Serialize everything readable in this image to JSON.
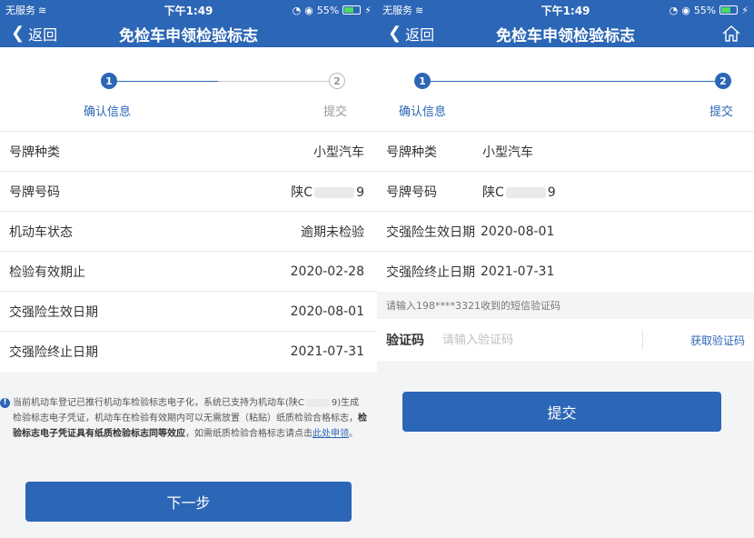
{
  "left": {
    "status": {
      "carrier": "无服务",
      "time": "下午1:49",
      "battery": "55%"
    },
    "nav": {
      "back": "返回",
      "title": "免检车申领检验标志"
    },
    "steps": [
      {
        "num": "1",
        "label": "确认信息"
      },
      {
        "num": "2",
        "label": "提交"
      }
    ],
    "rows": [
      {
        "label": "号牌种类",
        "value": "小型汽车"
      },
      {
        "label": "号牌号码",
        "value_prefix": "陕C",
        "value_suffix": "9"
      },
      {
        "label": "机动车状态",
        "value": "逾期未检验"
      },
      {
        "label": "检验有效期止",
        "value": "2020-02-28"
      },
      {
        "label": "交强险生效日期",
        "value": "2020-08-01"
      },
      {
        "label": "交强险终止日期",
        "value": "2021-07-31"
      }
    ],
    "notice": {
      "part1": "当前机动车登记已推行机动车检验标志电子化，系统已支持为机动车(陕C",
      "part2": "9)生成检验标志电子凭证，机动车在检验有效期内可以无需放置（粘贴）纸质检验合格标志，",
      "part3": "检验标志电子凭证具有纸质检验标志同等效应",
      "part4": "，如需纸质检验合格标志请点击",
      "link": "此处申领",
      "part5": "。"
    },
    "button": "下一步"
  },
  "right": {
    "status": {
      "carrier": "无服务",
      "time": "下午1:49",
      "battery": "55%"
    },
    "nav": {
      "back": "返回",
      "title": "免检车申领检验标志",
      "home_icon": "home-icon"
    },
    "steps": [
      {
        "num": "1",
        "label": "确认信息"
      },
      {
        "num": "2",
        "label": "提交"
      }
    ],
    "rows": [
      {
        "label": "号牌种类",
        "value": "小型汽车"
      },
      {
        "label": "号牌号码",
        "value_prefix": "陕C",
        "value_suffix": "9"
      },
      {
        "label": "交强险生效日期",
        "value": "2020-08-01"
      },
      {
        "label": "交强险终止日期",
        "value": "2021-07-31"
      }
    ],
    "sms_hint": "请输入198****3321收到的短信验证码",
    "code": {
      "label": "验证码",
      "placeholder": "请输入验证码",
      "get_code": "获取验证码"
    },
    "button": "提交"
  },
  "colors": {
    "brand": "#2c66b6",
    "background": "#f3f4f6"
  }
}
